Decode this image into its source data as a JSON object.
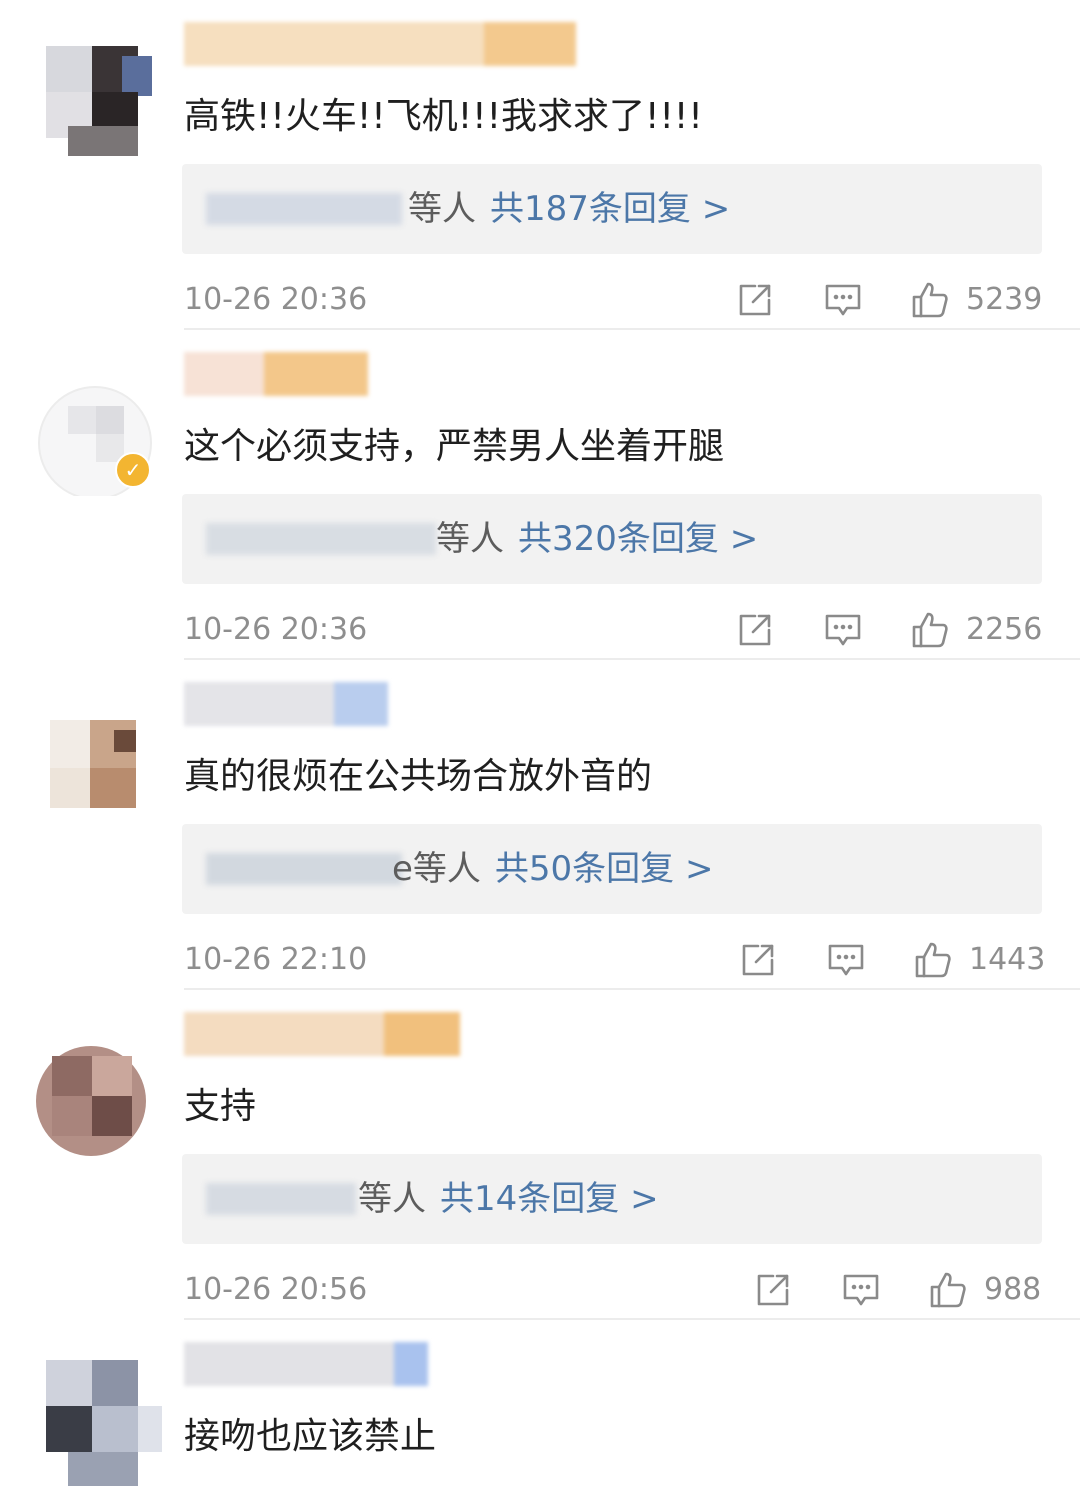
{
  "comments": [
    {
      "content": "高铁!!火车!!飞机!!!我求求了!!!!",
      "reply_suffix": "等人",
      "reply_count_text": "共187条回复 >",
      "timestamp": "10-26 20:36",
      "likes": "5239"
    },
    {
      "content": "这个必须支持，严禁男人坐着开腿",
      "reply_suffix": "等人",
      "reply_count_text": "共320条回复 >",
      "timestamp": "10-26 20:36",
      "likes": "2256"
    },
    {
      "content": "真的很烦在公共场合放外音的",
      "reply_suffix": "e等人",
      "reply_count_text": "共50条回复 >",
      "timestamp": "10-26 22:10",
      "likes": "1443"
    },
    {
      "content": "支持",
      "reply_suffix": "等人",
      "reply_count_text": "共14条回复 >",
      "timestamp": "10-26 20:56",
      "likes": "988"
    },
    {
      "content": "接吻也应该禁止"
    }
  ],
  "icons": {
    "share": "share-icon",
    "comment": "comment-icon",
    "like": "thumbs-up-icon",
    "verified": "verified-badge-icon"
  },
  "colors": {
    "reply_link": "#4c77a8",
    "meta_text": "#8e8e8e",
    "reply_box_bg": "#f2f2f2",
    "verified_badge": "#f3b531"
  }
}
